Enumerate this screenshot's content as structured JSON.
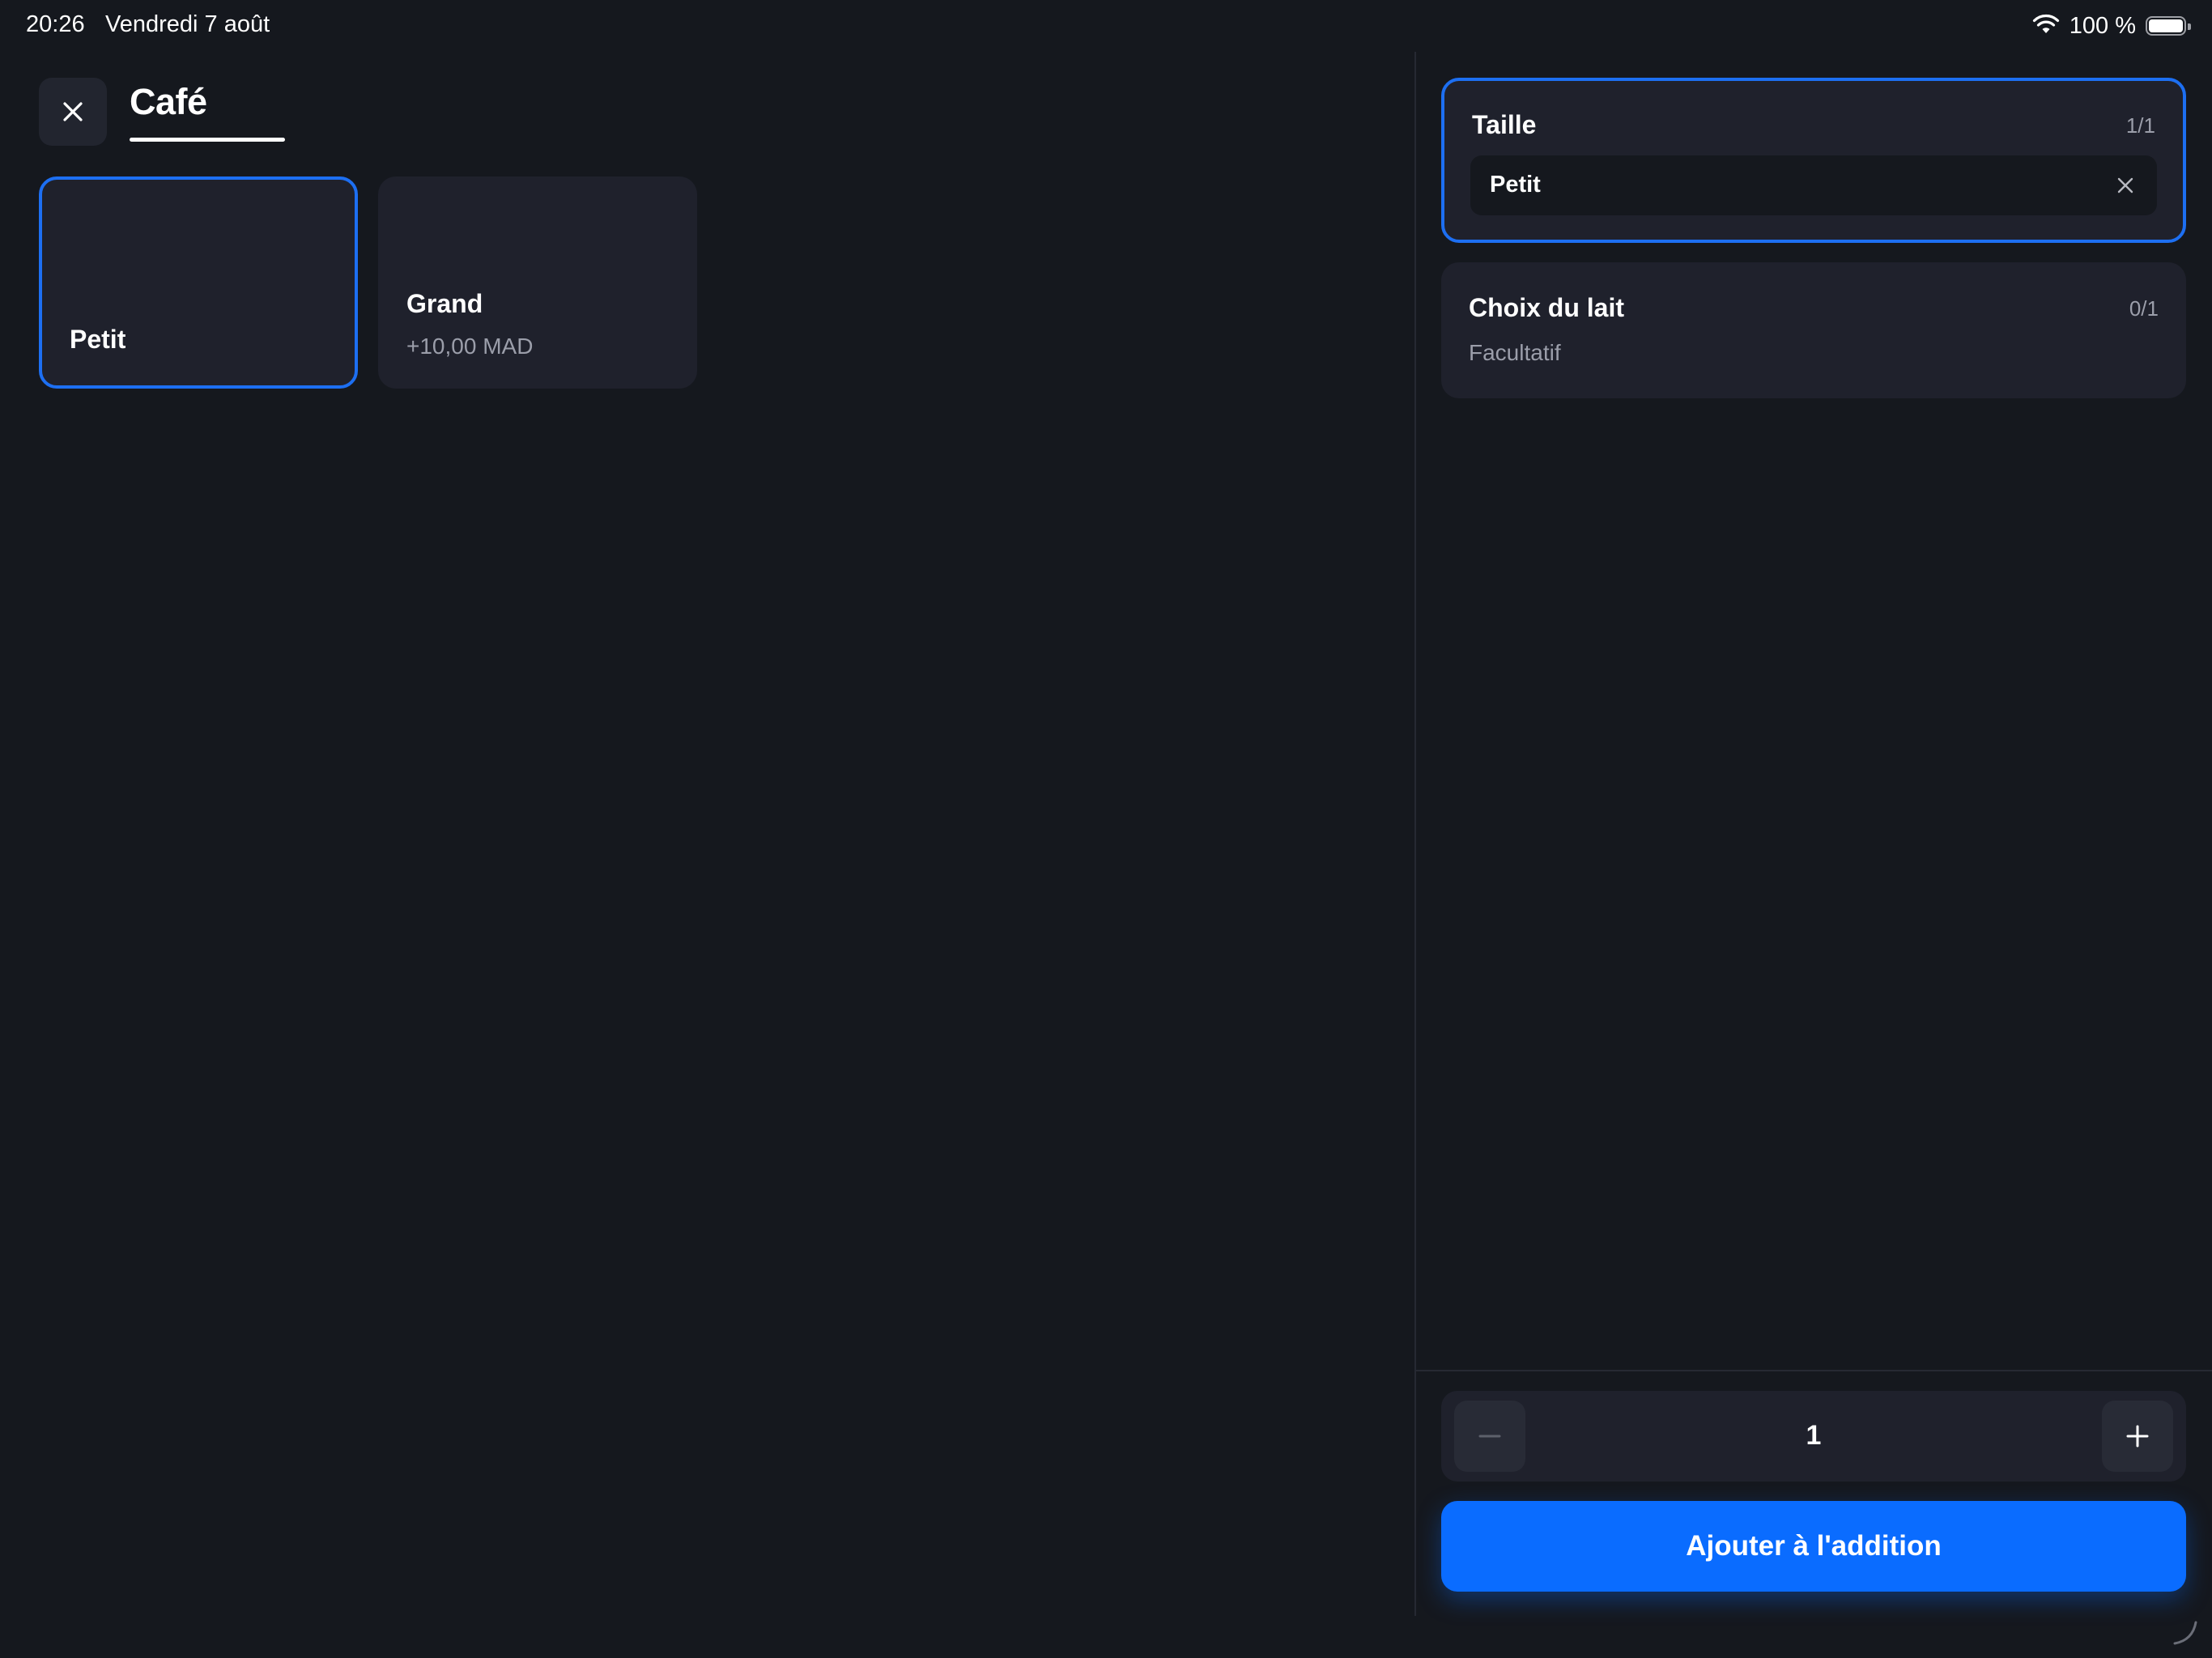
{
  "status_bar": {
    "time": "20:26",
    "date": "Vendredi 7 août",
    "battery": "100 %",
    "icons": [
      "wifi-icon",
      "battery-icon"
    ]
  },
  "header": {
    "close_icon": "close-icon",
    "category_title": "Café"
  },
  "options": [
    {
      "label": "Petit",
      "price": "",
      "selected": true
    },
    {
      "label": "Grand",
      "price": "+10,00 MAD",
      "selected": false
    }
  ],
  "groups": {
    "taille": {
      "title": "Taille",
      "count": "1/1",
      "selected_value": "Petit"
    },
    "lait": {
      "title": "Choix du lait",
      "count": "0/1",
      "subtitle": "Facultatif"
    }
  },
  "quantity": {
    "value": "1",
    "minus_icon": "minus-icon",
    "plus_icon": "plus-icon"
  },
  "actions": {
    "add_label": "Ajouter à l'addition"
  },
  "colors": {
    "background": "#15181e",
    "card": "#1f212c",
    "accent": "#0a6cff",
    "selection_border": "#1d6ff2",
    "muted_text": "#9b9eaa"
  }
}
